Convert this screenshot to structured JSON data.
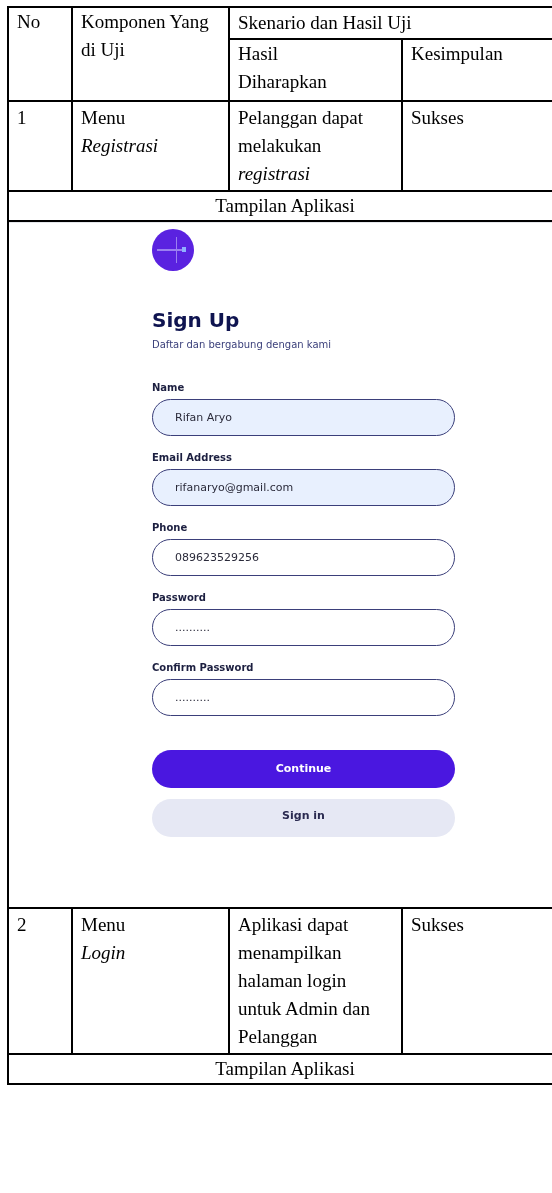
{
  "table": {
    "columns": {
      "no": "No",
      "component": "Komponen Yang di Uji",
      "group": "Skenario dan Hasil Uji",
      "expected": "Hasil Diharapkan",
      "conclusion": "Kesimpulan"
    },
    "rows": [
      {
        "no": "1",
        "component": "Menu *Registrasi*",
        "expected": "Pelanggan dapat melakukan *registrasi*",
        "conclusion": "Sukses",
        "display_label": "Tampilan Aplikasi",
        "app": {
          "title": "Sign Up",
          "subtitle": "Daftar dan bergabung dengan kami",
          "fields": [
            {
              "label": "Name",
              "value": "Rifan Aryo",
              "autofilled": true
            },
            {
              "label": "Email Address",
              "value": "rifanaryo@gmail.com",
              "autofilled": true
            },
            {
              "label": "Phone",
              "value": "089623529256",
              "autofilled": false
            },
            {
              "label": "Password",
              "value": "..........",
              "autofilled": false
            },
            {
              "label": "Confirm Password",
              "value": "..........",
              "autofilled": false
            }
          ],
          "buttons": [
            {
              "label": "Continue",
              "kind": "primary"
            },
            {
              "label": "Sign in",
              "kind": "secondary"
            }
          ]
        }
      },
      {
        "no": "2",
        "component": "Menu *Login*",
        "expected": "Aplikasi dapat menampilkan halaman login untuk Admin dan Pelanggan",
        "conclusion": "Sukses",
        "display_label": "Tampilan Aplikasi"
      }
    ]
  }
}
